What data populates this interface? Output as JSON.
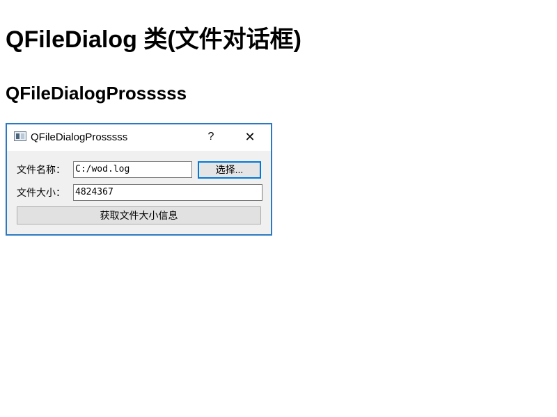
{
  "page": {
    "heading": "QFileDialog 类(文件对话框)",
    "subheading": "QFileDialogProsssss"
  },
  "dialog": {
    "title": "QFileDialogProsssss",
    "help_glyph": "?",
    "close_glyph": "✕",
    "file_name_label": "文件名称：",
    "file_name_value": "C:/wod.log",
    "select_button": "选择...",
    "file_size_label": "文件大小：",
    "file_size_value": "4824367",
    "get_info_button": "获取文件大小信息"
  },
  "colors": {
    "window_border": "#2b79c2",
    "focus_border": "#0078d7",
    "dialog_bg": "#f0f0f0"
  },
  "icons": {
    "app": "app-window-icon",
    "help": "help-icon",
    "close": "close-icon"
  }
}
